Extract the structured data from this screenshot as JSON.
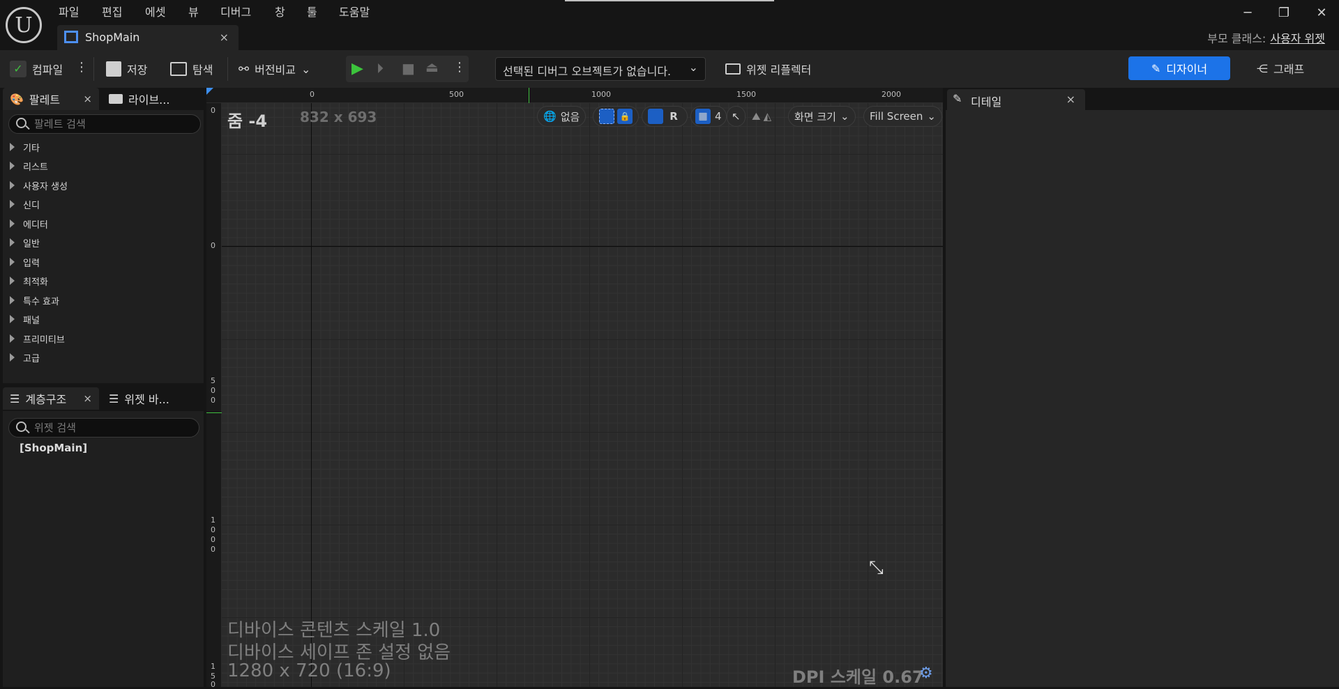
{
  "menu": [
    "파일",
    "편집",
    "에셋",
    "뷰",
    "디버그",
    "창",
    "툴",
    "도움말"
  ],
  "document_tab": {
    "title": "ShopMain",
    "close": "×"
  },
  "parent_class": {
    "label": "부모 클래스:",
    "value": "사용자 위젯"
  },
  "window_controls": {
    "minimize": "─",
    "restore": "❐",
    "close": "✕"
  },
  "toolbar": {
    "compile": "컴파일",
    "save": "저장",
    "browse": "탐색",
    "diff": "버전비교",
    "debug_object": "선택된 디버그 오브젝트가 없습니다.",
    "widget_reflector": "위젯 리플렉터",
    "designer": "디자이너",
    "graph": "그래프"
  },
  "palette": {
    "tab_label": "팔레트",
    "library_tab": "라이브...",
    "search_placeholder": "팔레트 검색",
    "categories": [
      "기타",
      "리스트",
      "사용자 생성",
      "신디",
      "에디터",
      "일반",
      "입력",
      "최적화",
      "특수 효과",
      "패널",
      "프리미티브",
      "고급"
    ]
  },
  "hierarchy": {
    "tab_label": "계층구조",
    "bindings_tab": "위젯 바...",
    "search_placeholder": "위젯 검색",
    "root_item": "[ShopMain]"
  },
  "canvas": {
    "zoom": "줌 -4",
    "size": "832 x 693",
    "ruler_top": [
      "0",
      "500",
      "1000",
      "1500",
      "2000"
    ],
    "ruler_left": [
      "0",
      "0",
      "5",
      "0",
      "0",
      "1",
      "0",
      "0",
      "0",
      "1",
      "5",
      "0"
    ],
    "toolbar": {
      "world": "없음",
      "r_button": "R",
      "grid_snap": "4",
      "screen_size": "화면 크기",
      "fill_mode": "Fill Screen"
    },
    "device_scale": "디바이스 콘텐츠 스케일 1.0",
    "safe_zone": "디바이스 세이프 존 설정 없음",
    "resolution": "1280 x 720 (16:9)",
    "dpi": "DPI 스케일 0.67"
  },
  "details": {
    "tab_label": "디테일",
    "close": "×"
  }
}
